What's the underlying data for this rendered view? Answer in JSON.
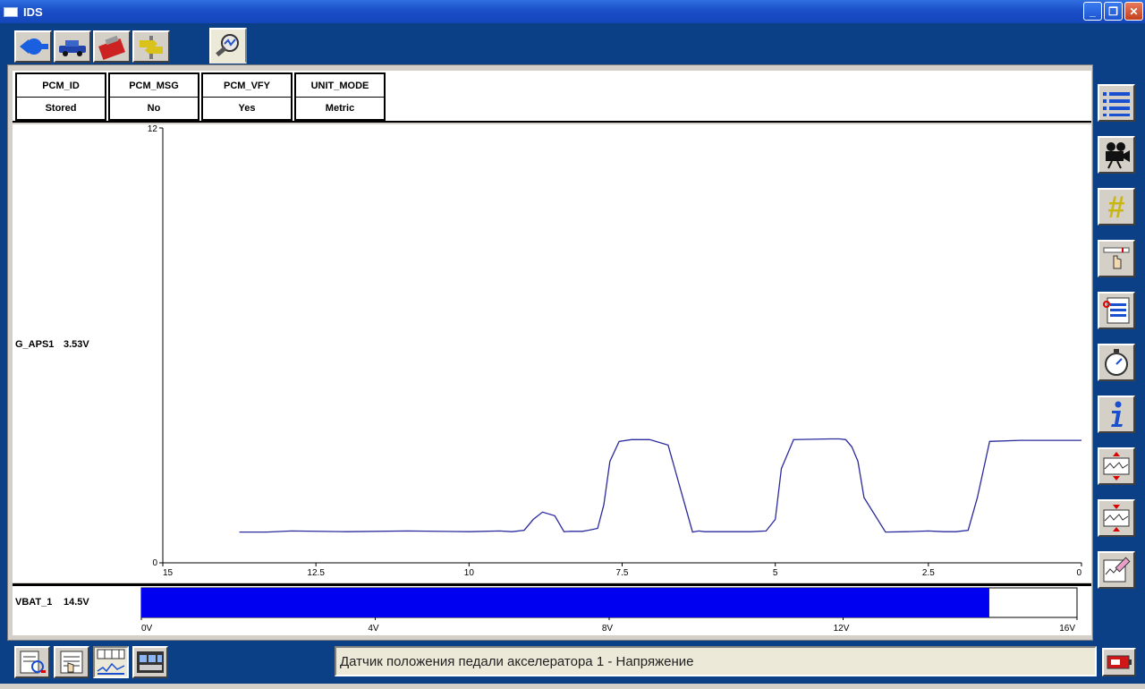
{
  "window": {
    "title": "IDS",
    "minimize": "_",
    "maximize": "❐",
    "close": "✕"
  },
  "top_toolbar": {
    "icons": [
      "connect-icon",
      "vehicle-icon",
      "toolbox-icon",
      "signpost-icon",
      "datalogger-icon"
    ]
  },
  "pid_header": [
    {
      "label": "PCM_ID",
      "value": "Stored"
    },
    {
      "label": "PCM_MSG",
      "value": "No"
    },
    {
      "label": "PCM_VFY",
      "value": "Yes"
    },
    {
      "label": "UNIT_MODE",
      "value": "Metric"
    }
  ],
  "graph_pid": {
    "name": "G_APS1",
    "value": "3.53V"
  },
  "chart_data": {
    "type": "line",
    "series": [
      {
        "name": "G_APS1",
        "x": [
          13.75,
          13.3,
          12.9,
          12.0,
          11.0,
          10.0,
          9.5,
          9.3,
          9.1,
          8.95,
          8.8,
          8.6,
          8.45,
          8.35,
          8.15,
          8.05,
          7.9,
          7.8,
          7.7,
          7.55,
          7.35,
          7.25,
          7.15,
          7.05,
          6.75,
          6.35,
          6.25,
          6.15,
          6.0,
          5.8,
          5.4,
          5.15,
          5.0,
          4.9,
          4.7,
          4.1,
          3.95,
          3.85,
          3.75,
          3.65,
          3.55,
          3.2,
          2.85,
          2.5,
          2.25,
          2.15,
          2.05,
          1.85,
          1.7,
          1.5,
          1.0,
          0.5,
          0.0
        ],
        "y": [
          0.85,
          0.85,
          0.88,
          0.86,
          0.88,
          0.86,
          0.88,
          0.86,
          0.9,
          1.2,
          1.4,
          1.3,
          0.86,
          0.87,
          0.87,
          0.9,
          0.95,
          1.6,
          2.8,
          3.35,
          3.4,
          3.4,
          3.4,
          3.4,
          3.25,
          0.85,
          0.88,
          0.86,
          0.86,
          0.86,
          0.86,
          0.88,
          1.2,
          2.6,
          3.4,
          3.42,
          3.42,
          3.4,
          3.2,
          2.8,
          1.8,
          0.85,
          0.86,
          0.88,
          0.86,
          0.86,
          0.86,
          0.9,
          1.8,
          3.35,
          3.38,
          3.38,
          3.38
        ]
      }
    ],
    "xlim": [
      15,
      0
    ],
    "ylim": [
      0,
      12
    ],
    "x_ticks": [
      "15",
      "12.5",
      "10",
      "7.5",
      "5",
      "2.5",
      "0"
    ],
    "y_ticks": [
      "0",
      "12"
    ],
    "grid": false
  },
  "bar_pid": {
    "name": "VBAT_1",
    "value": "14.5V",
    "level": 14.5,
    "max": 16,
    "ticks": [
      "0V",
      "4V",
      "8V",
      "12V",
      "16V"
    ]
  },
  "right_toolbar": {
    "icons": [
      "list-icon",
      "camera-icon",
      "hash-icon",
      "trigger-icon",
      "playback-icon",
      "stopwatch-icon",
      "info-icon",
      "graph-expand-icon",
      "graph-collapse-icon",
      "graph-edit-icon"
    ]
  },
  "bottom_toolbar": {
    "icons": [
      "pid-select-icon",
      "pid-list-icon",
      "graph-view-icon",
      "filmstrip-icon"
    ]
  },
  "status": {
    "text": "Датчик положения педали акселератора 1 - Напряжение"
  },
  "colors": {
    "trace": "#2a2a9c",
    "bar_fill": "#0000f0",
    "frame": "#0b3f86"
  }
}
